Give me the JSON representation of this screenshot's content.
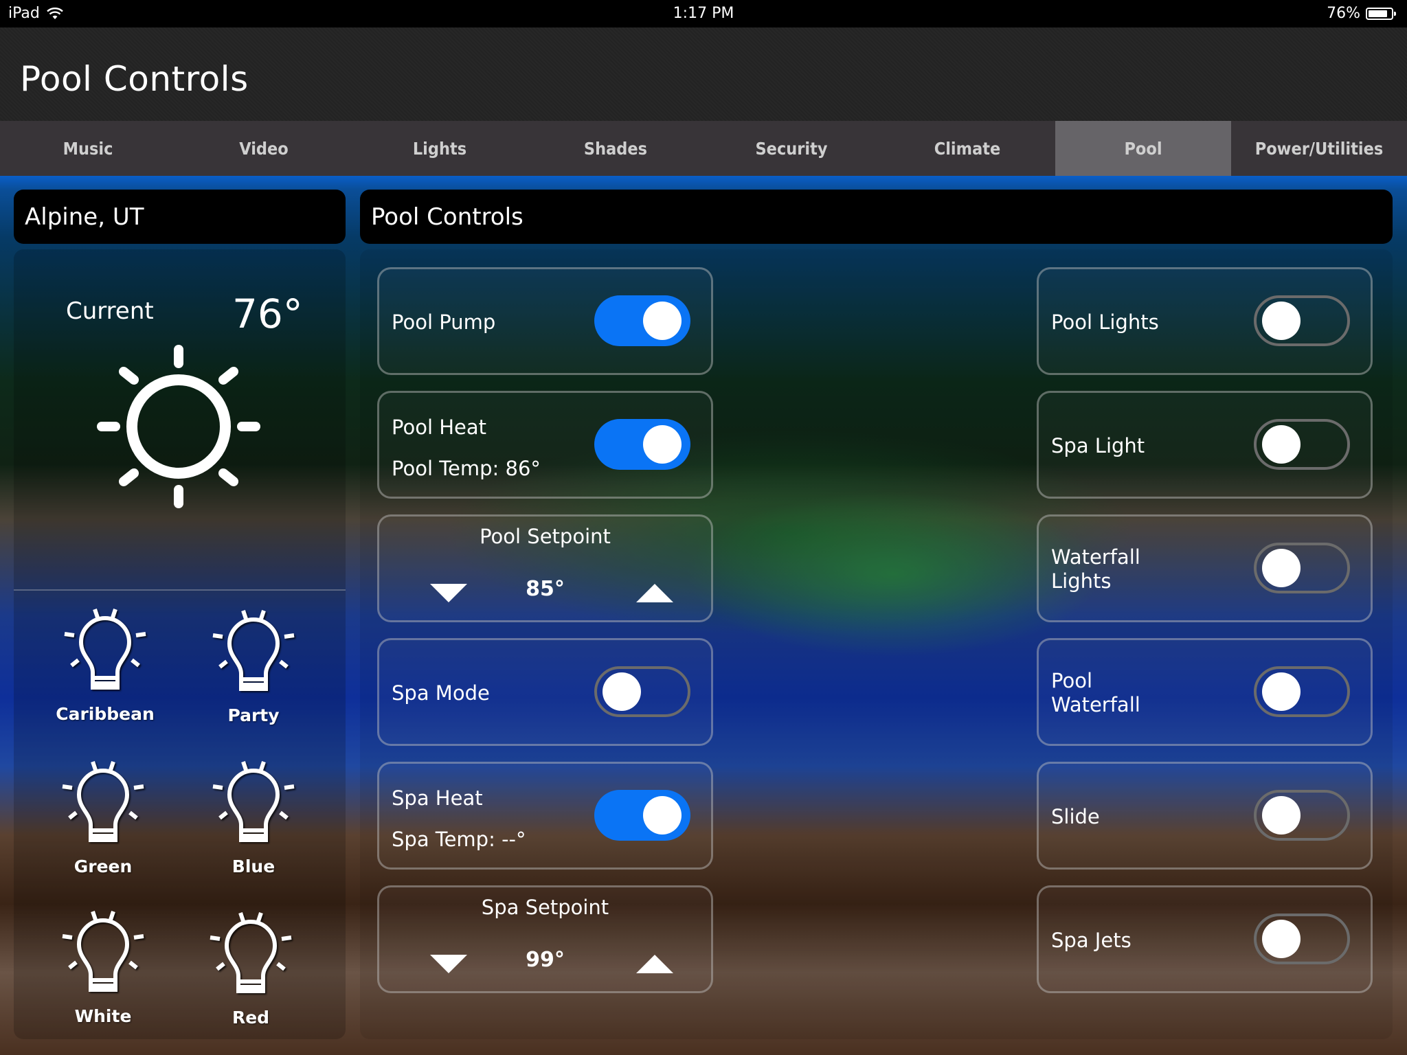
{
  "status_bar": {
    "device": "iPad",
    "time": "1:17 PM",
    "battery": "76%",
    "battery_level": 0.76
  },
  "app_title": "Pool Controls",
  "tabs": [
    {
      "label": "Music"
    },
    {
      "label": "Video"
    },
    {
      "label": "Lights"
    },
    {
      "label": "Shades"
    },
    {
      "label": "Security"
    },
    {
      "label": "Climate"
    },
    {
      "label": "Pool",
      "active": true
    },
    {
      "label": "Power/Utilities"
    }
  ],
  "weather": {
    "location": "Alpine, UT",
    "current_label": "Current",
    "current_temp": "76°",
    "condition_icon": "sun-icon"
  },
  "light_scenes": [
    {
      "label": "Caribbean"
    },
    {
      "label": "Party"
    },
    {
      "label": "Green"
    },
    {
      "label": "Blue"
    },
    {
      "label": "White"
    },
    {
      "label": "Red"
    }
  ],
  "controls_header": "Pool Controls",
  "left_controls": {
    "pool_pump": {
      "label": "Pool Pump",
      "on": true
    },
    "pool_heat": {
      "label": "Pool Heat",
      "temp_text": "Pool Temp: 86°",
      "on": true
    },
    "pool_setpoint": {
      "label": "Pool Setpoint",
      "value": "85°"
    },
    "spa_mode": {
      "label": "Spa Mode",
      "on": false
    },
    "spa_heat": {
      "label": "Spa Heat",
      "temp_text": "Spa Temp: --°",
      "on": true
    },
    "spa_setpoint": {
      "label": "Spa Setpoint",
      "value": "99°"
    }
  },
  "right_controls": [
    {
      "label": "Pool Lights",
      "on": false
    },
    {
      "label": "Spa Light",
      "on": false
    },
    {
      "label": "Waterfall Lights",
      "on": false
    },
    {
      "label": "Pool Waterfall",
      "on": false
    },
    {
      "label": "Slide",
      "on": false
    },
    {
      "label": "Spa Jets",
      "on": false
    }
  ],
  "colors": {
    "toggle_on": "#0a74f5",
    "tab_active": "#666468",
    "tab_bar": "#383438"
  }
}
